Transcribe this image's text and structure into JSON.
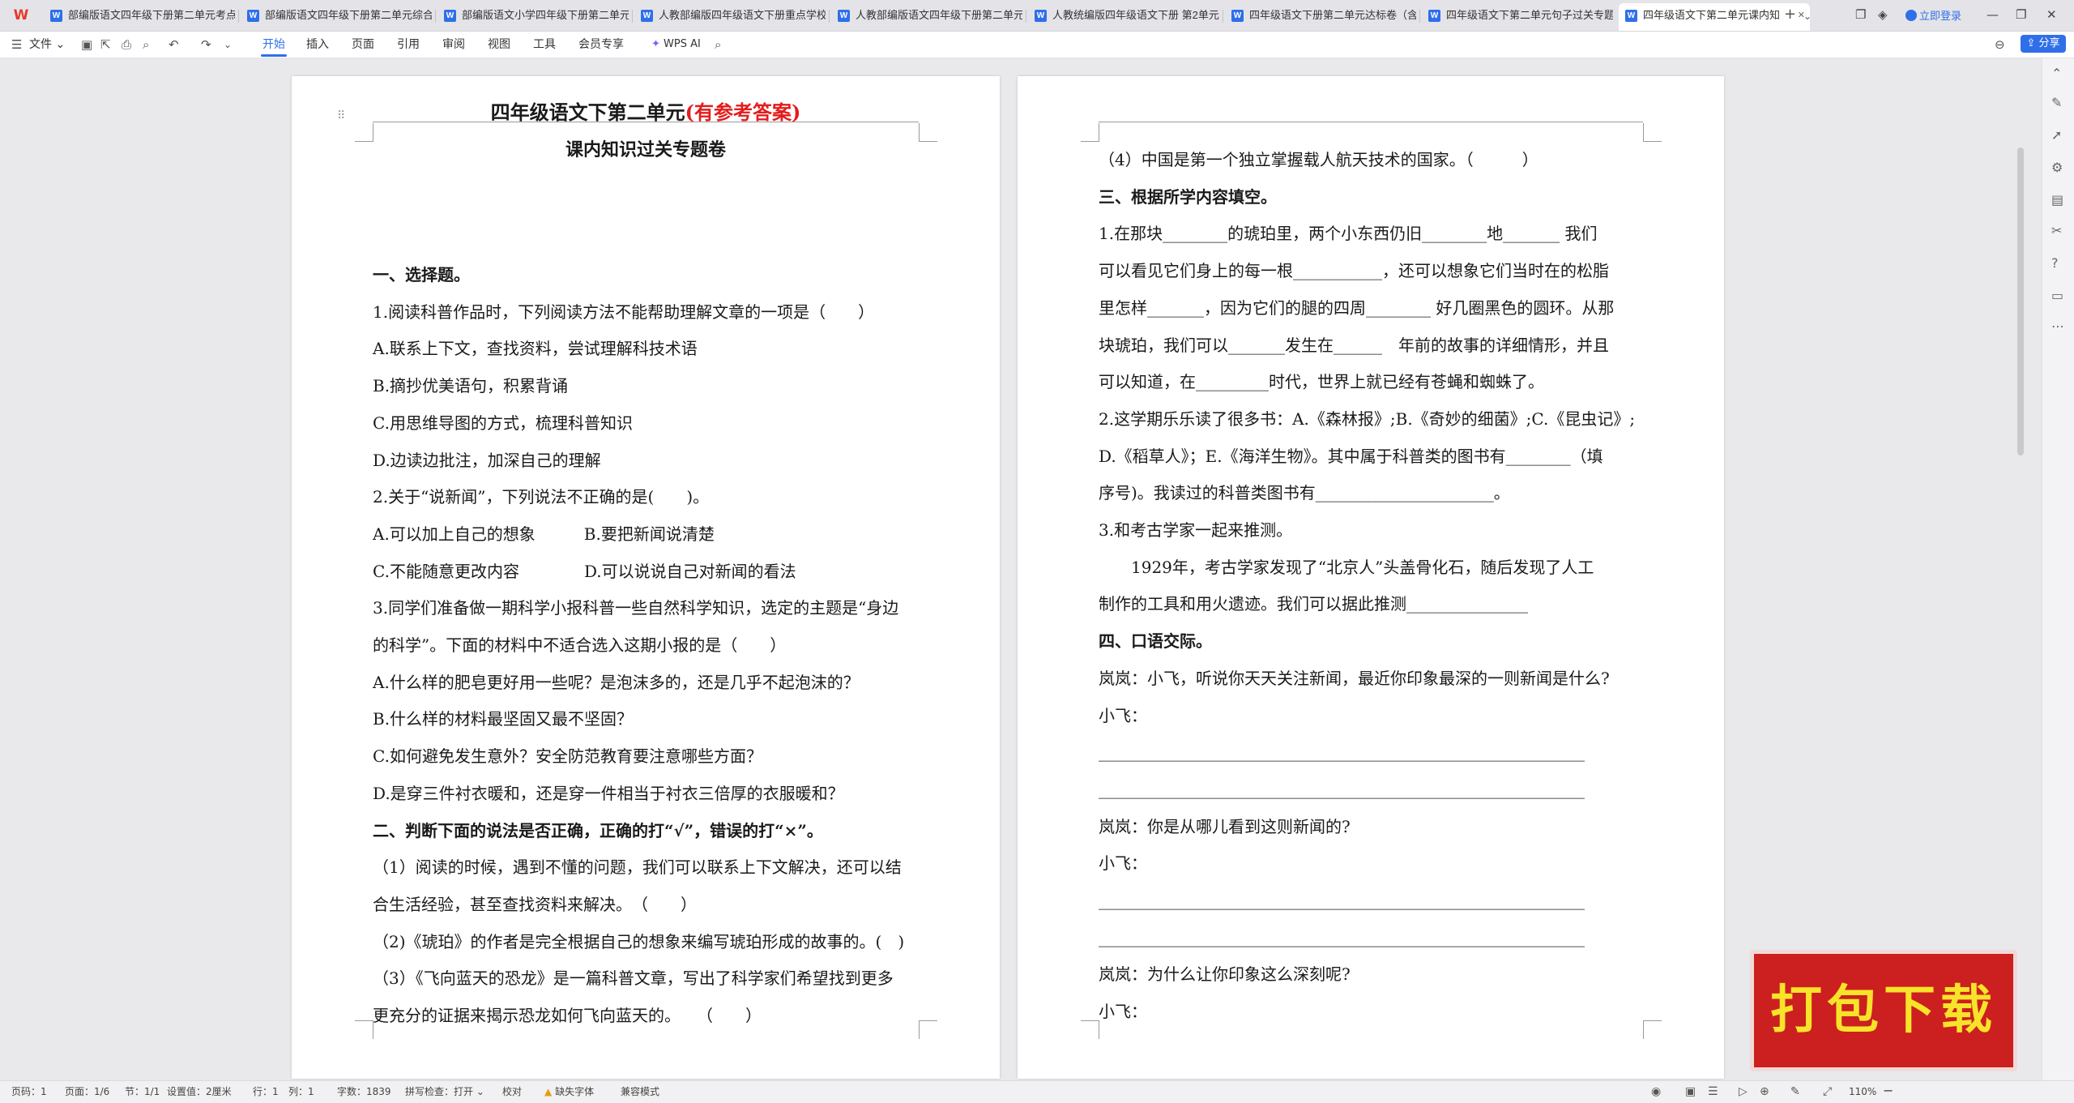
{
  "tabs": [
    {
      "label": "部编版语文四年级下册第二单元考点",
      "active": false
    },
    {
      "label": "部编版语文四年级下册第二单元综合",
      "active": false
    },
    {
      "label": "部编版语文小学四年级下册第二单元",
      "active": false
    },
    {
      "label": "人教部编版四年级语文下册重点学校",
      "active": false
    },
    {
      "label": "人教部编版语文四年级下册第二单元",
      "active": false
    },
    {
      "label": "人教统编版四年级语文下册 第2单元",
      "active": false
    },
    {
      "label": "四年级语文下册第二单元达标卷（含",
      "active": false
    },
    {
      "label": "四年级语文下第二单元句子过关专题",
      "active": false
    },
    {
      "label": "四年级语文下第二单元课内知",
      "active": true
    }
  ],
  "titlebar": {
    "login": "立即登录"
  },
  "toolbar": {
    "file": "文件",
    "menus": [
      "开始",
      "插入",
      "页面",
      "引用",
      "审阅",
      "视图",
      "工具",
      "会员专享"
    ],
    "active_menu": "开始",
    "wps_ai": "WPS AI",
    "share": "分享"
  },
  "doc": {
    "title_main": "四年级语文下第二单元",
    "title_red": "(有参考答案)",
    "subtitle": "课内知识过关专题卷",
    "page1": [
      {
        "text": "一、选择题。",
        "bold": true
      },
      {
        "text": "1.阅读科普作品时，下列阅读方法不能帮助理解文章的一项是（　　）"
      },
      {
        "text": "A.联系上下文，查找资料，尝试理解科技术语"
      },
      {
        "text": "B.摘抄优美语句，积累背诵"
      },
      {
        "text": "C.用思维导图的方式，梳理科普知识"
      },
      {
        "text": "D.边读边批注，加深自己的理解"
      },
      {
        "text": "2.关于“说新闻”，下列说法不正确的是(　　)。"
      },
      {
        "text": "A.可以加上自己的想象　　　B.要把新闻说清楚"
      },
      {
        "text": "C.不能随意更改内容　　　　D.可以说说自己对新闻的看法"
      },
      {
        "text": "3.同学们准备做一期科学小报科普一些自然科学知识，选定的主题是“身边"
      },
      {
        "text": "的科学”。下面的材料中不适合选入这期小报的是（　　）"
      },
      {
        "text": "A.什么样的肥皂更好用一些呢？是泡沫多的，还是几乎不起泡沫的？"
      },
      {
        "text": "B.什么样的材料最坚固又最不坚固？"
      },
      {
        "text": "C.如何避免发生意外？安全防范教育要注意哪些方面？"
      },
      {
        "text": "D.是穿三件衬衣暖和，还是穿一件相当于衬衣三倍厚的衣服暖和？"
      },
      {
        "text": "二、判断下面的说法是否正确，正确的打“√”，错误的打“×”。",
        "bold": true
      },
      {
        "text": "（1）阅读的时候，遇到不懂的问题，我们可以联系上下文解决，还可以结"
      },
      {
        "text": "合生活经验，甚至查找资料来解决。　（　　）"
      },
      {
        "text": "（2)《琥珀》的作者是完全根据自己的想象来编写琥珀形成的故事的。(　)"
      },
      {
        "text": "（3）《飞向蓝天的恐龙》是一篇科普文章，写出了科学家们希望找到更多"
      },
      {
        "text": "更充分的证据来揭示恐龙如何飞向蓝天的。　　（　　）"
      }
    ],
    "page2": [
      {
        "text": "（4）中国是第一个独立掌握载人航天技术的国家。（　　　）"
      },
      {
        "text": "三、根据所学内容填空。",
        "bold": true
      },
      {
        "text": "1.在那块________的琥珀里，两个小东西仍旧________地_______ 我们"
      },
      {
        "text": "可以看见它们身上的每一根___________，还可以想象它们当时在的松脂"
      },
      {
        "text": "里怎样_______，因为它们的腿的四周________ 好几圈黑色的圆环。从那"
      },
      {
        "text": "块琥珀，我们可以_______发生在______　年前的故事的详细情形，并且"
      },
      {
        "text": "可以知道，在_________时代，世界上就已经有苍蝇和蜘蛛了。"
      },
      {
        "text": "2.这学期乐乐读了很多书：A.《森林报》;B.《奇妙的细菌》;C.《昆虫记》;"
      },
      {
        "text": "D.《稻草人》；E.《海洋生物》。其中属于科普类的图书有________（填"
      },
      {
        "text": "序号)。我读过的科普类图书有______________________。"
      },
      {
        "text": "3.和考古学家一起来推测。"
      },
      {
        "text": "　　1929年，考古学家发现了“北京人”头盖骨化石，随后发现了人工"
      },
      {
        "text": "制作的工具和用火遗迹。我们可以据此推测_______________"
      },
      {
        "text": "四、口语交际。",
        "bold": true
      },
      {
        "text": "岚岚：小飞，听说你天天关注新闻，最近你印象最深的一则新闻是什么?"
      },
      {
        "text": "小飞："
      },
      {
        "text": "____________________________________________________________"
      },
      {
        "text": "____________________________________________________________"
      },
      {
        "text": "岚岚：你是从哪儿看到这则新闻的?"
      },
      {
        "text": "小飞："
      },
      {
        "text": "____________________________________________________________"
      },
      {
        "text": "____________________________________________________________"
      },
      {
        "text": "岚岚：为什么让你印象这么深刻呢?"
      },
      {
        "text": "小飞："
      }
    ]
  },
  "badge": {
    "text": "打包下载"
  },
  "statusbar": {
    "page_num": "页码：1",
    "pages": "页面：1/6",
    "section": "节：1/1",
    "setting": "设置值：2厘米",
    "row": "行：1",
    "col": "列：1",
    "words": "字数：1839",
    "spell": "拼写检查：打开",
    "proof": "校对",
    "missing_font": "缺失字体",
    "compat": "兼容模式",
    "zoom": "110%"
  },
  "colors": {
    "accent": "#2f6fea",
    "red_title": "#e31c1c",
    "badge_bg": "#cc1f1f",
    "badge_text": "#f7e32a"
  }
}
